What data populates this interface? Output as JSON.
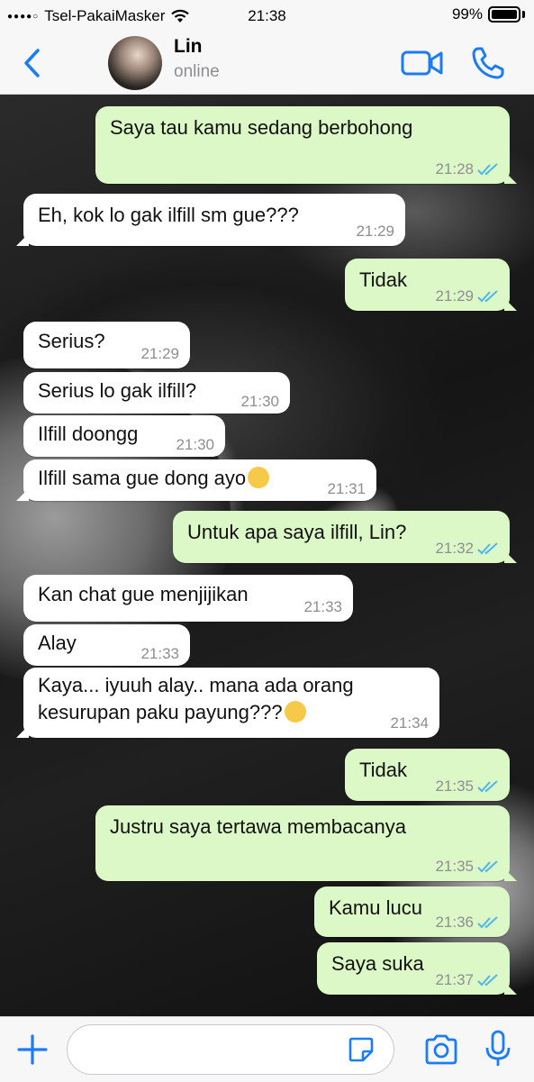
{
  "status_bar": {
    "carrier": "Tsel-PakaiMasker",
    "time": "21:38",
    "battery": "99%"
  },
  "header": {
    "name": "Lin",
    "presence": "online"
  },
  "messages": [
    {
      "text": "Saya tau kamu sedang berbohong",
      "time": "21:28"
    },
    {
      "text": "Eh, kok lo gak ilfill sm gue???",
      "time": "21:29"
    },
    {
      "text": "Tidak",
      "time": "21:29"
    },
    {
      "text": "Serius?",
      "time": "21:29"
    },
    {
      "text": "Serius lo gak ilfill?",
      "time": "21:30"
    },
    {
      "text": "Ilfill doongg",
      "time": "21:30"
    },
    {
      "text": "Ilfill sama gue dong ayo",
      "time": "21:31"
    },
    {
      "text": "Untuk apa saya ilfill, Lin?",
      "time": "21:32"
    },
    {
      "text": "Kan chat gue menjijikan",
      "time": "21:33"
    },
    {
      "text": "Alay",
      "time": "21:33"
    },
    {
      "text": "Kaya... iyuuh alay.. mana ada orang\nkesurupan paku payung???",
      "time": "21:34"
    },
    {
      "text": "Tidak",
      "time": "21:35"
    },
    {
      "text": "Justru saya tertawa membacanya",
      "time": "21:35"
    },
    {
      "text": "Kamu lucu",
      "time": "21:36"
    },
    {
      "text": "Saya suka",
      "time": "21:37"
    }
  ],
  "input": {
    "value": ""
  },
  "colors": {
    "accent": "#1a7cf7",
    "outgoing_bubble": "#dcf8c6",
    "incoming_bubble": "#ffffff",
    "read_ticks": "#4fb6ec"
  }
}
